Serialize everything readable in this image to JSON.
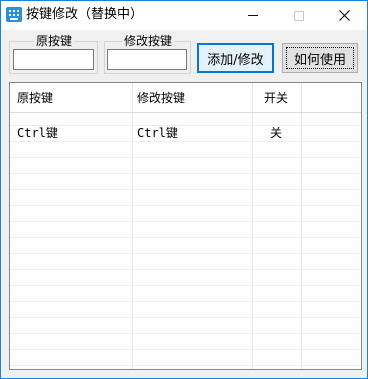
{
  "window": {
    "title": "按键修改（替换中）",
    "border_color": "#1883d7",
    "icon": "keyboard-icon"
  },
  "titlebar": {
    "minimize_symbol": "—",
    "maximize_symbol": "□",
    "close_symbol": "✕"
  },
  "form": {
    "original_key_label": "原按键",
    "original_key_value": "",
    "modified_key_label": "修改按键",
    "modified_key_value": ""
  },
  "buttons": {
    "add_modify": "添加/修改",
    "how_to_use": "如何使用",
    "accent_color": "#0078d7"
  },
  "table": {
    "columns": [
      "原按键",
      "修改按键",
      "开关"
    ],
    "rows": [
      [
        "Ctrl键",
        "Ctrl键",
        "关"
      ]
    ]
  }
}
